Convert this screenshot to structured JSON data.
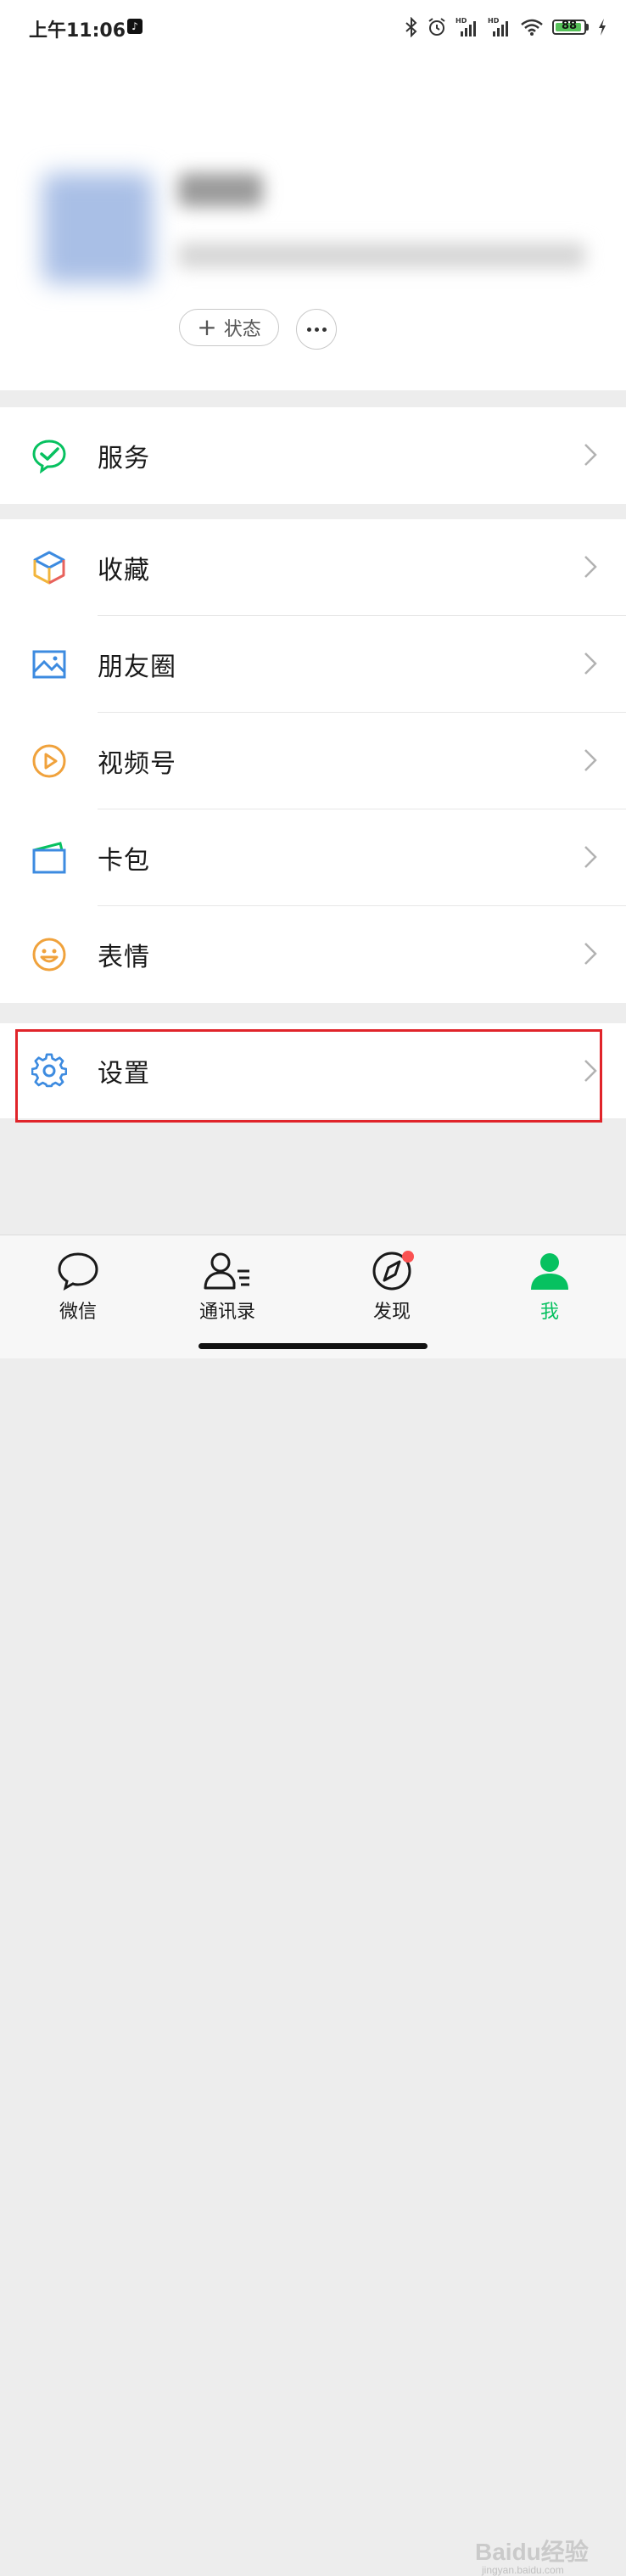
{
  "status_bar": {
    "time": "上午11:06",
    "hd_label": "HD",
    "battery": "88"
  },
  "profile": {
    "status_button": "状态"
  },
  "menu": {
    "service": "服务",
    "favorites": "收藏",
    "moments": "朋友圈",
    "channels": "视频号",
    "cards": "卡包",
    "stickers": "表情",
    "settings": "设置"
  },
  "tabs": [
    {
      "label": "微信"
    },
    {
      "label": "通讯录"
    },
    {
      "label": "发现"
    },
    {
      "label": "我"
    }
  ],
  "watermark": {
    "text": "Baidu经验",
    "sub": "jingyan.baidu.com"
  },
  "colors": {
    "accent": "#07c160",
    "highlight": "#e0242a",
    "badge": "#fa5151"
  }
}
